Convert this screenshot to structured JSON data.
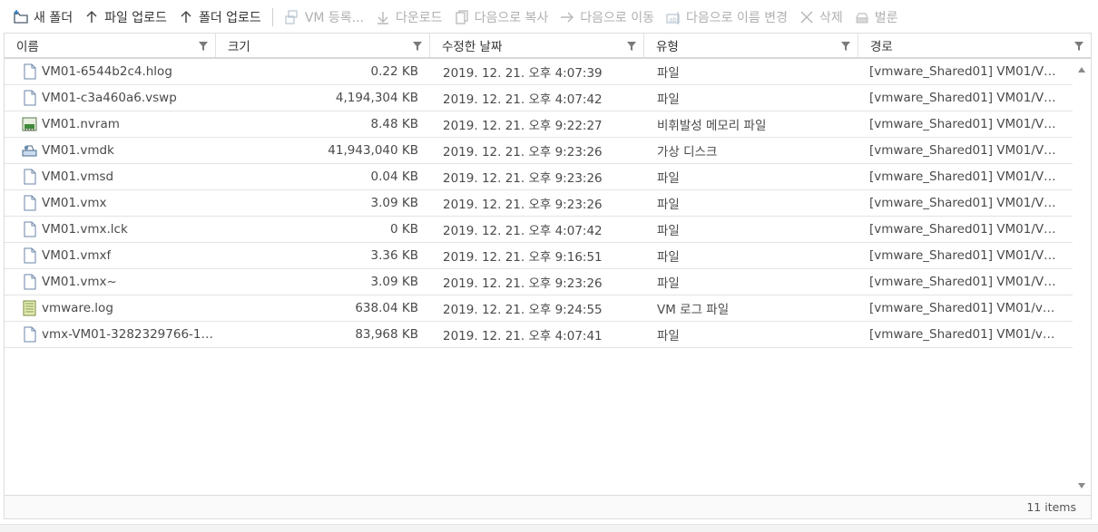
{
  "toolbar": {
    "new_folder": "새 폴더",
    "upload_file": "파일 업로드",
    "upload_folder": "폴더 업로드",
    "register_vm": "VM 등록...",
    "download": "다운로드",
    "copy_to": "다음으로 복사",
    "move_to": "다음으로 이동",
    "rename_to": "다음으로 이름 변경",
    "delete": "삭제",
    "inflate": "벌룬"
  },
  "columns": {
    "name": "이름",
    "size": "크기",
    "modified": "수정한 날짜",
    "type": "유형",
    "path": "경로"
  },
  "rows": [
    {
      "name": "VM01-6544b2c4.hlog",
      "size": "0.22 KB",
      "modified": "2019. 12. 21. 오후 4:07:39",
      "type": "파일",
      "path": "[vmware_Shared01] VM01/VM...",
      "icon": "file-icon"
    },
    {
      "name": "VM01-c3a460a6.vswp",
      "size": "4,194,304 KB",
      "modified": "2019. 12. 21. 오후 4:07:42",
      "type": "파일",
      "path": "[vmware_Shared01] VM01/VM...",
      "icon": "file-icon"
    },
    {
      "name": "VM01.nvram",
      "size": "8.48 KB",
      "modified": "2019. 12. 21. 오후 9:22:27",
      "type": "비휘발성 메모리 파일",
      "path": "[vmware_Shared01] VM01/VM...",
      "icon": "nvram-icon"
    },
    {
      "name": "VM01.vmdk",
      "size": "41,943,040 KB",
      "modified": "2019. 12. 21. 오후 9:23:26",
      "type": "가상 디스크",
      "path": "[vmware_Shared01] VM01/VM...",
      "icon": "virtual-disk-icon"
    },
    {
      "name": "VM01.vmsd",
      "size": "0.04 KB",
      "modified": "2019. 12. 21. 오후 9:23:26",
      "type": "파일",
      "path": "[vmware_Shared01] VM01/VM...",
      "icon": "file-icon"
    },
    {
      "name": "VM01.vmx",
      "size": "3.09 KB",
      "modified": "2019. 12. 21. 오후 9:23:26",
      "type": "파일",
      "path": "[vmware_Shared01] VM01/VM...",
      "icon": "file-icon"
    },
    {
      "name": "VM01.vmx.lck",
      "size": "0 KB",
      "modified": "2019. 12. 21. 오후 4:07:42",
      "type": "파일",
      "path": "[vmware_Shared01] VM01/VM...",
      "icon": "file-icon"
    },
    {
      "name": "VM01.vmxf",
      "size": "3.36 KB",
      "modified": "2019. 12. 21. 오후 9:16:51",
      "type": "파일",
      "path": "[vmware_Shared01] VM01/VM...",
      "icon": "file-icon"
    },
    {
      "name": "VM01.vmx~",
      "size": "3.09 KB",
      "modified": "2019. 12. 21. 오후 9:23:26",
      "type": "파일",
      "path": "[vmware_Shared01] VM01/VM...",
      "icon": "file-icon"
    },
    {
      "name": "vmware.log",
      "size": "638.04 KB",
      "modified": "2019. 12. 21. 오후 9:24:55",
      "type": "VM 로그 파일",
      "path": "[vmware_Shared01] VM01/vmw...",
      "icon": "log-file-icon"
    },
    {
      "name": "vmx-VM01-3282329766-1,...",
      "size": "83,968 KB",
      "modified": "2019. 12. 21. 오후 4:07:41",
      "type": "파일",
      "path": "[vmware_Shared01] VM01/vmx-...",
      "icon": "file-icon"
    }
  ],
  "footer": {
    "count": "11 items"
  }
}
